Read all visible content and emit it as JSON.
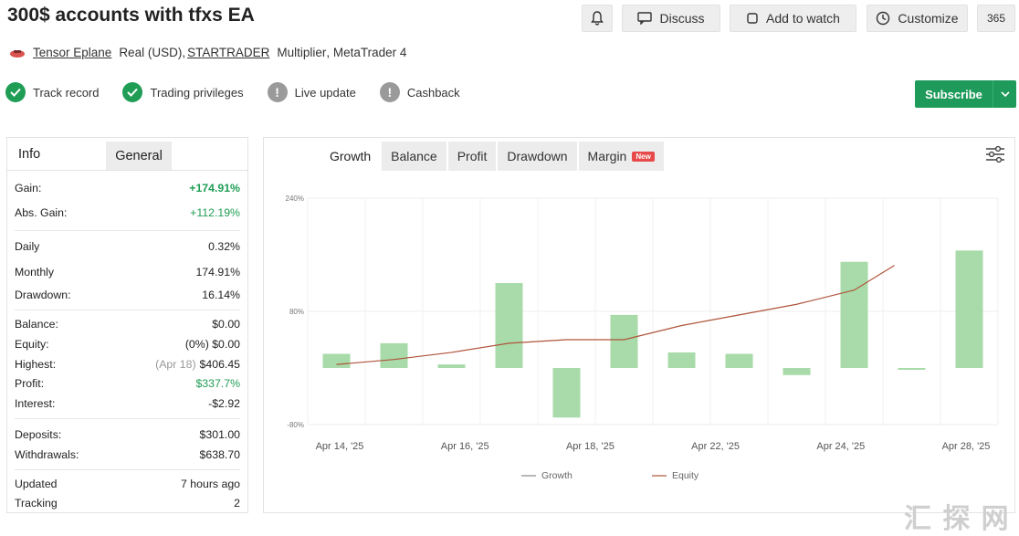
{
  "header": {
    "title": "300$ accounts with tfxs EA",
    "buttons": {
      "discuss": "Discuss",
      "watch": "Add to watch",
      "customize": "Customize",
      "more": "365"
    }
  },
  "subline": {
    "owner": "Tensor Eplane",
    "account_type": "Real (USD),",
    "broker": "STARTRADER",
    "leverage": "Multiplier",
    "platform": ", MetaTrader 4"
  },
  "badges": [
    {
      "label": "Track record",
      "status": "verified"
    },
    {
      "label": "Trading privileges",
      "status": "verified"
    },
    {
      "label": "Live update",
      "status": "warning"
    },
    {
      "label": "Cashback",
      "status": "warning"
    }
  ],
  "subscribe": {
    "label": "Subscribe"
  },
  "info": {
    "tabs": {
      "info": "Info",
      "general": "General"
    },
    "gain": {
      "label": "Gain:",
      "value": "+174.91%"
    },
    "abs_gain": {
      "label": "Abs. Gain:",
      "value": "+112.19%"
    },
    "daily": {
      "label": "Daily",
      "value": "0.32%"
    },
    "monthly": {
      "label": "Monthly",
      "value": "174.91%"
    },
    "drawdown": {
      "label": "Drawdown:",
      "value": "16.14%"
    },
    "balance": {
      "label": "Balance:",
      "value": "$0.00"
    },
    "equity": {
      "label": "Equity:",
      "prefix": "(0%)",
      "value": "$0.00"
    },
    "highest": {
      "label": "Highest:",
      "prefix": "(Apr 18)",
      "value": "$406.45"
    },
    "profit": {
      "label": "Profit:",
      "value": "$337.7%"
    },
    "interest": {
      "label": "Interest:",
      "value": "-$2.92"
    },
    "deposits": {
      "label": "Deposits:",
      "value": "$301.00"
    },
    "withdrawals": {
      "label": "Withdrawals:",
      "value": "$638.70"
    },
    "updated": {
      "label": "Updated",
      "value": "7 hours ago"
    },
    "tracking": {
      "label": "Tracking",
      "value": "2"
    }
  },
  "chart_tabs": {
    "growth": "Growth",
    "balance": "Balance",
    "profit": "Profit",
    "drawdown": "Drawdown",
    "margin": "Margin",
    "margin_badge": "New"
  },
  "colors": {
    "green": "#1f9d55",
    "bar": "#a8dba9",
    "line": "#b0533a",
    "accent": "#1e9a5a"
  },
  "chart_data": {
    "type": "bar",
    "y_ticks": [
      "240%",
      "80%",
      "-80%"
    ],
    "ylim": [
      -80,
      240
    ],
    "x_tick_labels": [
      "Apr 14, '25",
      "Apr 16, '25",
      "Apr 18, '25",
      "Apr 22, '25",
      "Apr 24, '25",
      "Apr 28, '25"
    ],
    "bars": [
      20,
      35,
      5,
      120,
      -70,
      75,
      22,
      20,
      -10,
      150,
      -1,
      166
    ],
    "line_x": [
      0,
      1,
      2,
      3,
      4,
      5,
      6,
      7,
      8,
      9,
      9.7
    ],
    "line_values": [
      5,
      12,
      22,
      35,
      40,
      40,
      60,
      75,
      90,
      110,
      145
    ],
    "legend": [
      "Growth",
      "Equity"
    ]
  }
}
